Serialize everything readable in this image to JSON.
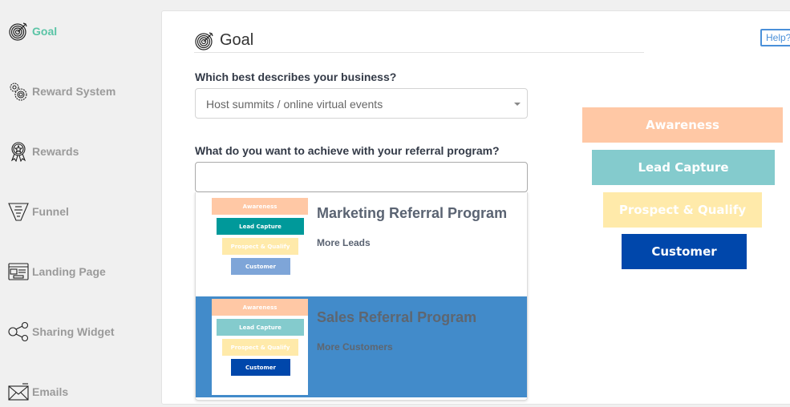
{
  "sidebar": {
    "items": [
      {
        "label": "Goal",
        "icon": "target-icon",
        "active": true
      },
      {
        "label": "Reward System",
        "icon": "gears-icon",
        "active": false
      },
      {
        "label": "Rewards",
        "icon": "award-ribbon-icon",
        "active": false
      },
      {
        "label": "Funnel",
        "icon": "funnel-icon",
        "active": false
      },
      {
        "label": "Landing Page",
        "icon": "webpage-icon",
        "active": false
      },
      {
        "label": "Sharing Widget",
        "icon": "share-icon",
        "active": false
      },
      {
        "label": "Emails",
        "icon": "envelope-icon",
        "active": false
      }
    ]
  },
  "main": {
    "title": "Goal",
    "help_label": "Help?",
    "question1": "Which best describes your business?",
    "business_select_value": "Host summits / online virtual events",
    "question2": "What do you want to achieve with your referral program?",
    "goal_select_value": "",
    "options": [
      {
        "title": "Marketing Referral Program",
        "subtitle": "More Leads",
        "highlighted": false
      },
      {
        "title": "Sales Referral Program",
        "subtitle": "More Customers",
        "highlighted": true
      }
    ]
  },
  "funnel": {
    "steps": [
      "Awareness",
      "Lead Capture",
      "Prospect & Qualify",
      "Customer"
    ],
    "colors": {
      "awareness": "#ffc8a5",
      "lead_capture_active": "#00999a",
      "lead_capture": "#84cbcd",
      "prospect": "#ffeaaa",
      "customer_active": "#0047ab",
      "customer": "#7ea5d8"
    }
  },
  "colors": {
    "accent": "#5bc4a6",
    "highlight": "#428bca",
    "help": "#4a90d9"
  }
}
